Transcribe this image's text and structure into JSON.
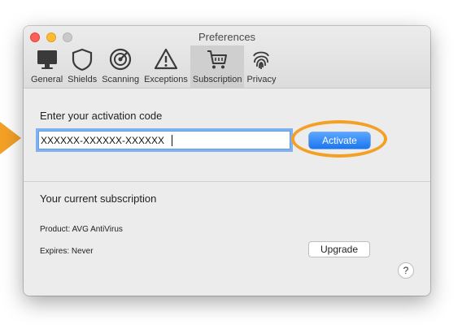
{
  "window": {
    "title": "Preferences"
  },
  "tabs": [
    {
      "label": "General",
      "icon": "monitor-icon"
    },
    {
      "label": "Shields",
      "icon": "shield-icon"
    },
    {
      "label": "Scanning",
      "icon": "radar-icon"
    },
    {
      "label": "Exceptions",
      "icon": "warning-icon"
    },
    {
      "label": "Subscription",
      "icon": "cart-icon",
      "active": true
    },
    {
      "label": "Privacy",
      "icon": "fingerprint-icon"
    }
  ],
  "activation": {
    "heading": "Enter your activation code",
    "code_value": "XXXXXX-XXXXXX-XXXXXX",
    "button_label": "Activate"
  },
  "subscription": {
    "heading": "Your current subscription",
    "product": "Product: AVG AntiVirus",
    "expires": "Expires: Never",
    "upgrade_label": "Upgrade"
  },
  "help": {
    "label": "?"
  },
  "colors": {
    "highlight": "#f3a126",
    "primary_button": "#2a82f5",
    "focus_ring": "#7fb1f0"
  }
}
